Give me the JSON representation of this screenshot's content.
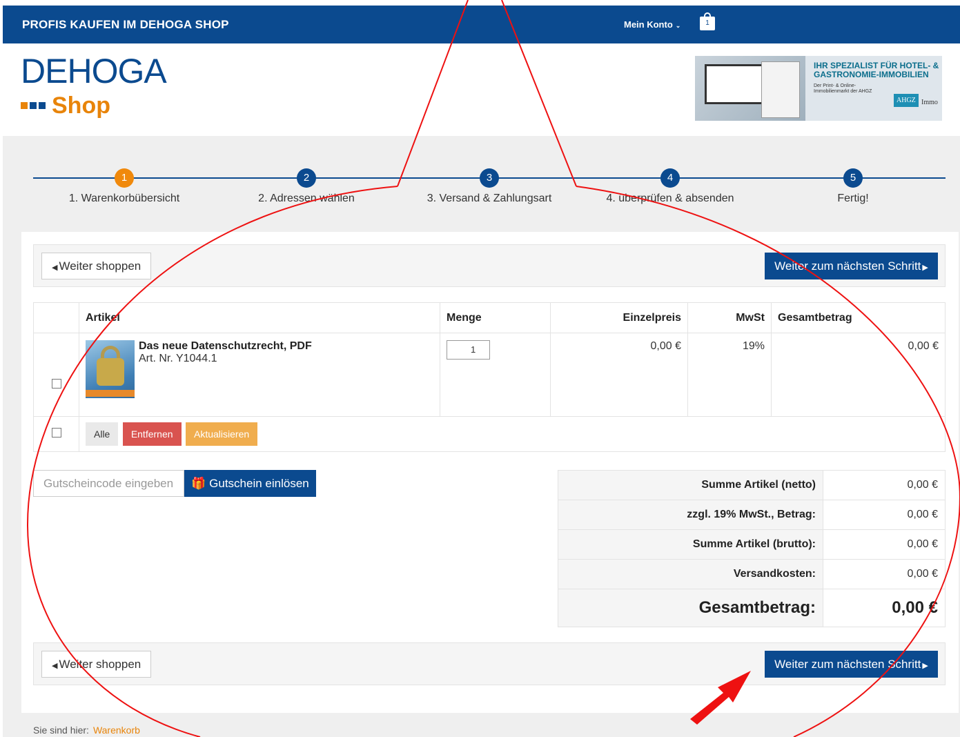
{
  "topbar": {
    "brandline": "PROFIS KAUFEN IM DEHOGA SHOP",
    "account": "Mein Konto",
    "cart_count": "1"
  },
  "logo": {
    "word": "DEHOGA",
    "sub": "Shop"
  },
  "banner": {
    "headline": "IHR SPEZIALIST FÜR HOTEL- & GASTRONOMIE-IMMOBILIEN",
    "text": "Der Print- & Online-Immobilienmarkt der AHGZ",
    "brand1": "AHGZ",
    "brand2": "Immo"
  },
  "steps": [
    {
      "num": "1",
      "label": "1. Warenkorbübersicht"
    },
    {
      "num": "2",
      "label": "2. Adressen wählen"
    },
    {
      "num": "3",
      "label": "3. Versand & Zahlungsart"
    },
    {
      "num": "4",
      "label": "4. überprüfen & absenden"
    },
    {
      "num": "5",
      "label": "Fertig!"
    }
  ],
  "nav": {
    "back": "Weiter shoppen",
    "next": "Weiter zum nächsten Schritt"
  },
  "table": {
    "headers": [
      "Artikel",
      "Menge",
      "Einzelpreis",
      "MwSt",
      "Gesamtbetrag"
    ],
    "item": {
      "name": "Das neue Datenschutzrecht, PDF",
      "artnr": "Art. Nr. Y1044.1",
      "qty": "1",
      "unit_price": "0,00 €",
      "vat": "19%",
      "total": "0,00 €"
    },
    "actions": {
      "all": "Alle",
      "remove": "Entfernen",
      "update": "Aktualisieren"
    }
  },
  "coupon": {
    "placeholder": "Gutscheincode eingeben",
    "button": "Gutschein einlösen"
  },
  "summary": [
    {
      "label": "Summe Artikel (netto)",
      "value": "0,00 €"
    },
    {
      "label": "zzgl. 19% MwSt., Betrag:",
      "value": "0,00 €"
    },
    {
      "label": "Summe Artikel (brutto):",
      "value": "0,00 €"
    },
    {
      "label": "Versandkosten:",
      "value": "0,00 €"
    },
    {
      "label": "Gesamtbetrag:",
      "value": "0,00 €"
    }
  ],
  "breadcrumb": {
    "prefix": "Sie sind hier:",
    "current": "Warenkorb"
  },
  "colors": {
    "primary": "#0b4a8f",
    "accent": "#f0890c",
    "danger": "#d9534f",
    "warning": "#f0ad4e",
    "annotation": "#ee1111"
  }
}
